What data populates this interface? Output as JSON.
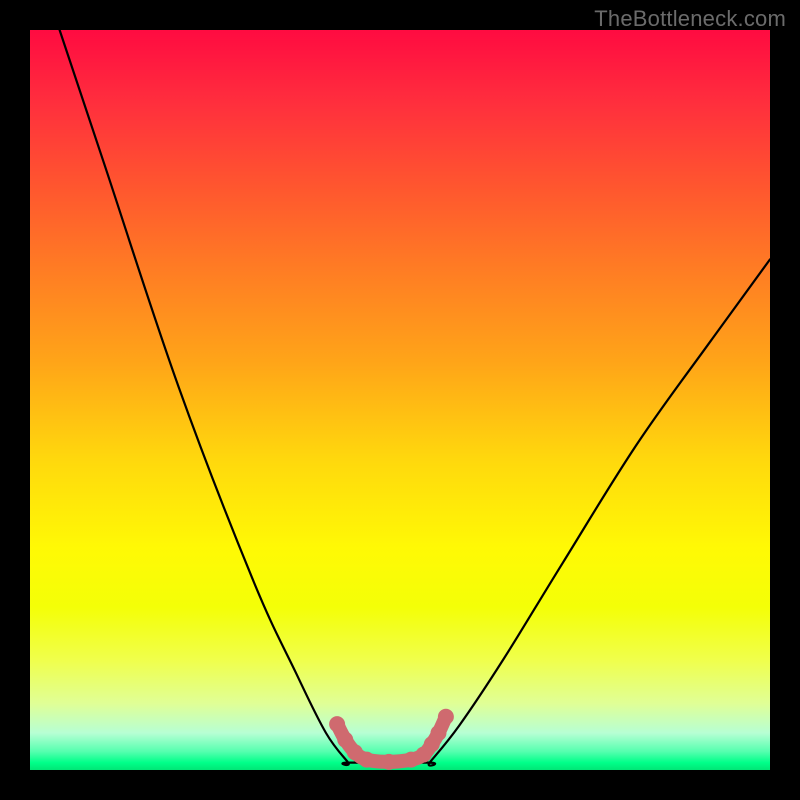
{
  "watermark": {
    "text": "TheBottleneck.com"
  },
  "chart_data": {
    "type": "line",
    "title": "",
    "xlabel": "",
    "ylabel": "",
    "xlim": [
      0,
      100
    ],
    "ylim": [
      0,
      100
    ],
    "grid": false,
    "legend": false,
    "series": [
      {
        "name": "left-curve",
        "x": [
          4,
          10,
          20,
          30,
          36,
          40,
          43
        ],
        "values": [
          100,
          82,
          52,
          26,
          13,
          5,
          1
        ]
      },
      {
        "name": "right-curve",
        "x": [
          54,
          58,
          64,
          72,
          82,
          92,
          100
        ],
        "values": [
          1,
          6,
          15,
          28,
          44,
          58,
          69
        ]
      },
      {
        "name": "flat-valley",
        "x": [
          43,
          54
        ],
        "values": [
          1,
          1
        ]
      }
    ],
    "annotations": [
      {
        "name": "pink-valley-overlay",
        "style": "thick-pink",
        "x": [
          41.5,
          42.6,
          43.9,
          45.5,
          48.5,
          51.5,
          53.2,
          54.3,
          55.2,
          56.2
        ],
        "values": [
          6.2,
          4.1,
          2.4,
          1.4,
          1.1,
          1.4,
          2.1,
          3.5,
          5.0,
          7.2
        ]
      }
    ]
  }
}
